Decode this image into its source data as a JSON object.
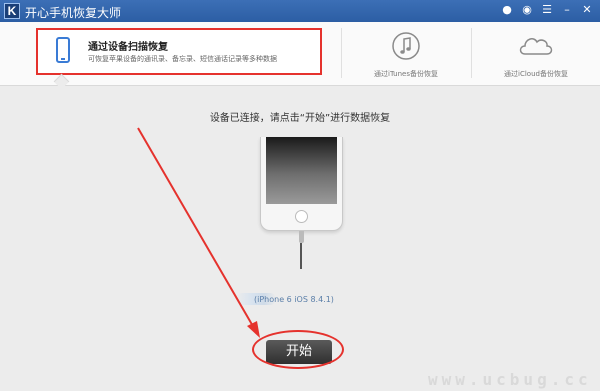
{
  "window": {
    "logo_letter": "K",
    "title": "开心手机恢复大师",
    "controls": [
      "wechat-icon",
      "chat-icon",
      "menu-icon",
      "minimize-icon",
      "close-icon"
    ]
  },
  "tabs": {
    "active": {
      "title": "通过设备扫描恢复",
      "description": "可恢复苹果设备的通讯录、备忘录、短信通话记录等多种数据",
      "icon": "phone-icon"
    },
    "itunes": {
      "label": "通过iTunes备份恢复",
      "icon": "music-note-icon"
    },
    "icloud": {
      "label": "通过iCloud备份恢复",
      "icon": "cloud-icon"
    }
  },
  "main": {
    "instruction": "设备已连接，请点击“开始”进行数据恢复",
    "device_label": "(iPhone 6 iOS 8.4.1)",
    "start_label": "开始"
  },
  "watermark": "www.ucbug.cc",
  "colors": {
    "accent_blue": "#2c5ea4",
    "highlight_red": "#e5322d",
    "button_dark": "#3a3a3a"
  }
}
